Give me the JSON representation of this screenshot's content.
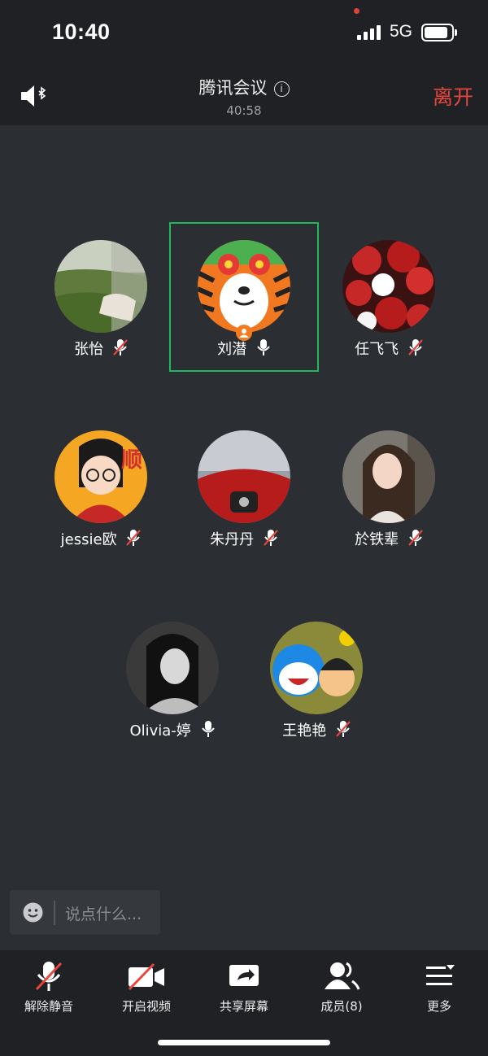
{
  "status_bar": {
    "time": "10:40",
    "network": "5G",
    "icons": [
      "signal-icon",
      "battery-icon"
    ]
  },
  "header": {
    "title": "腾讯会议",
    "duration": "40:58",
    "leave_label": "离开",
    "icons": [
      "speaker-bluetooth-icon",
      "info-icon"
    ],
    "accent_color": "#e8453c"
  },
  "participants": [
    {
      "name": "张怡",
      "mic": "muted"
    },
    {
      "name": "刘潜",
      "mic": "on",
      "active_speaker": true,
      "host": true
    },
    {
      "name": "任飞飞",
      "mic": "muted"
    },
    {
      "name": "jessie欧",
      "mic": "muted"
    },
    {
      "name": "朱丹丹",
      "mic": "muted"
    },
    {
      "name": "於铁辈",
      "mic": "muted"
    },
    {
      "name": "Olivia-婷",
      "mic": "on"
    },
    {
      "name": "王艳艳",
      "mic": "muted"
    }
  ],
  "chat": {
    "placeholder": "说点什么..."
  },
  "toolbar": {
    "unmute_label": "解除静音",
    "video_label": "开启视频",
    "share_label": "共享屏幕",
    "members_label": "成员(8)",
    "more_label": "更多"
  },
  "colors": {
    "active_border": "#1fb85a",
    "mute_slash": "#e8453c",
    "host_badge": "#f27c1f"
  }
}
